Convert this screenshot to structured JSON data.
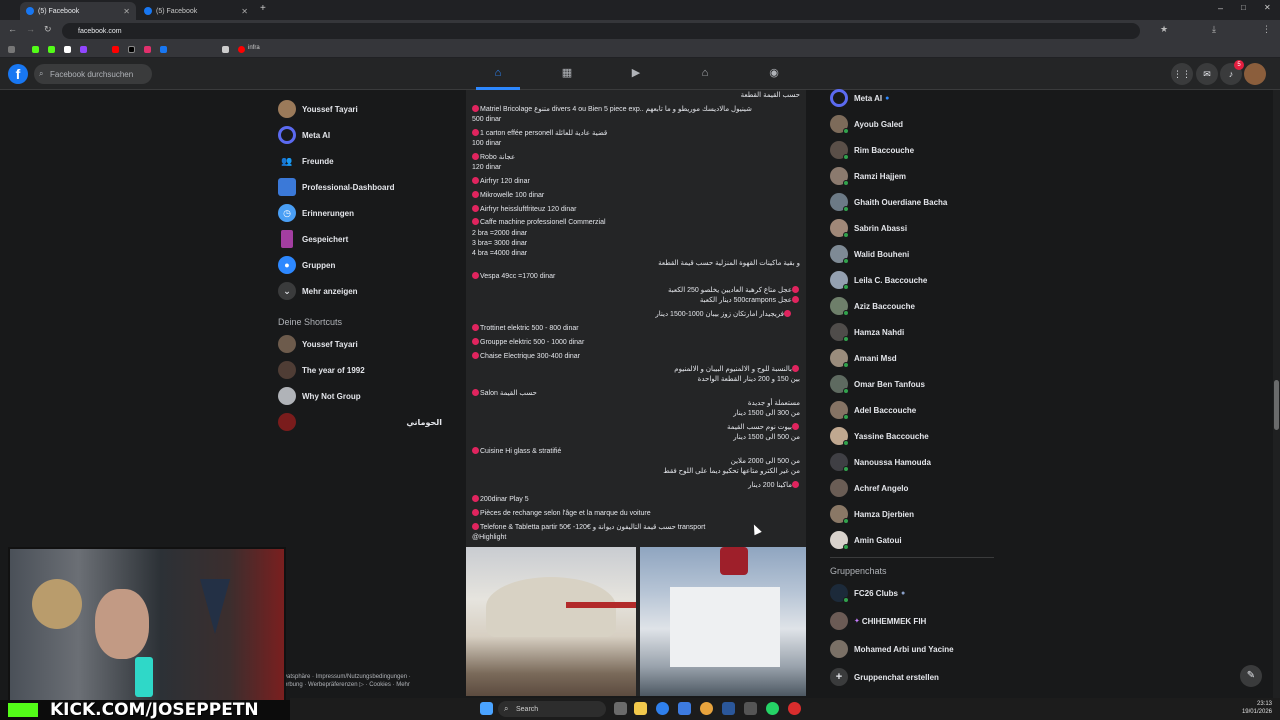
{
  "browser": {
    "tabs": [
      {
        "label": "(5) Facebook"
      },
      {
        "label": "(5) Facebook"
      }
    ],
    "url": "facebook.com",
    "bookmark_label": "infra"
  },
  "header": {
    "logo": "f",
    "search_placeholder": "Facebook durchsuchen",
    "notification_count": "5"
  },
  "left_sidebar": {
    "items": [
      {
        "label": "Youssef Tayari"
      },
      {
        "label": "Meta AI"
      },
      {
        "label": "Freunde"
      },
      {
        "label": "Professional-Dashboard"
      },
      {
        "label": "Erinnerungen"
      },
      {
        "label": "Gespeichert"
      },
      {
        "label": "Gruppen"
      },
      {
        "label": "Mehr anzeigen"
      }
    ],
    "shortcuts_title": "Deine Shortcuts",
    "shortcuts": [
      {
        "label": "Youssef Tayari"
      },
      {
        "label": "The year of 1992"
      },
      {
        "label": "Why Not Group"
      },
      {
        "label": "الحوماني"
      }
    ],
    "footer_line1": "vatsphäre · Impressum/Nutzungsbedingungen ·",
    "footer_line2": "erbung · Werbepräferenzen ▷ · Cookies · Mehr"
  },
  "post": {
    "lines": [
      "حسب القيمة القطعة",
      "Matriel Bricolage متنوع divers 4 ou Bien 5 piece exp.. شينيول مالاديسك موريطو و ما تابعهم",
      "500 dinar",
      "1 carton effée personell قضية عادية للعائلة",
      "100 dinar",
      "Robo عجانة",
      "120 dinar",
      "Airfryr 120 dinar",
      "Mikrowelle 100 dinar",
      "Airfryr heissluftfriteuz 120 dinar",
      "Caffe machine professionell Commerzial",
      "2 bra =2000 dinar",
      "3 bra= 3000 dinar",
      "4 bra =4000 dinar",
      "و بقية ماكينات القهوة المنزلية حسب قيمة القطعة",
      "Vespa 49cc =1700 dinar",
      "عجل متاع كرهبة العاديين يخلصو 250 الكعبة",
      "عجل 500crampons دينار الكعبة",
      "فريجيدار امارتكان زوز بيبان 1000-1500 دينار",
      "Trottinet elektric 500 - 800 dinar",
      "Grouppe elektric 500 - 1000 dinar",
      "Chaise Electrique 300-400 dinar",
      "بالنسبة للوح و الالمنيوم البيبان و الالمنيوم",
      "بين 150 و 200 دينار القطعة الواحدة",
      "Salon حسب القيمة",
      "مستعملة أو جديدة",
      "من 300 الى 1500 دينار",
      "بيوت نوم حسب القيمة",
      "من 500 الى 1500 دينار",
      "Cuisine Hi glass & stratifié",
      "من 500 الى 2000 ملاين",
      "من غير الكترو متاعها تحكيو ديما على اللوح فقط",
      "ماكينا 200 دينار",
      "200dinar Play 5",
      "Pièces de rechange selon l'âge et la marque du voiture",
      "Telefone & Tabletta partir 50€ -120€ حسب قيمة التاليفون ديوانة و transport",
      "@Highlight"
    ]
  },
  "right_sidebar": {
    "contacts": [
      {
        "label": "Meta AI"
      },
      {
        "label": "Ayoub Galed"
      },
      {
        "label": "Rim Baccouche"
      },
      {
        "label": "Ramzi Hajjem"
      },
      {
        "label": "Ghaith Ouerdiane Bacha"
      },
      {
        "label": "Sabrin Abassi"
      },
      {
        "label": "Walid Bouheni"
      },
      {
        "label": "Leila C. Baccouche"
      },
      {
        "label": "Aziz Baccouche"
      },
      {
        "label": "Hamza Nahdi"
      },
      {
        "label": "Amani Msd"
      },
      {
        "label": "Omar Ben Tanfous"
      },
      {
        "label": "Adel Baccouche"
      },
      {
        "label": "Yassine Baccouche"
      },
      {
        "label": "Nanoussa Hamouda"
      },
      {
        "label": "Achref Angelo"
      },
      {
        "label": "Hamza Djerbien"
      },
      {
        "label": "Amin Gatoui"
      }
    ],
    "group_chats_title": "Gruppenchats",
    "group_chats": [
      {
        "label": "FC26 Clubs"
      },
      {
        "label": "CHIHEMMEK FIH"
      },
      {
        "label": "Mohamed Arbi und Yacine"
      },
      {
        "label": "Gruppenchat erstellen"
      }
    ]
  },
  "stream": {
    "kick_text": "KICK.COM/JOSEPPETN"
  },
  "taskbar": {
    "search_label": "Search",
    "time": "23:13",
    "date": "19/01/2026"
  }
}
